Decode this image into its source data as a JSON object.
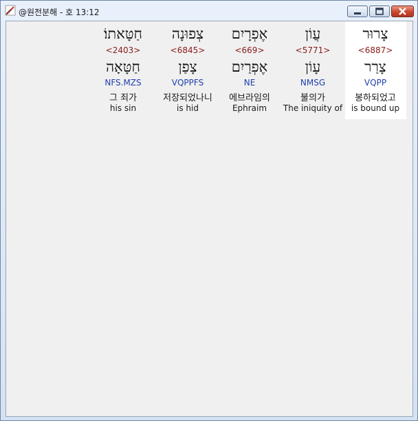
{
  "window": {
    "title": "@원전분해 - 호 13:12",
    "app_icon": "pencil-ruler-icon",
    "controls": [
      "minimize-icon",
      "maximize-icon",
      "close-icon"
    ]
  },
  "words": [
    {
      "hebrew": "צָרוּר",
      "strong": "<6887>",
      "lemma": "צָרַר",
      "morph": "VQPP",
      "korean": "봉하되었고",
      "english": "is bound up",
      "highlighted": true
    },
    {
      "hebrew": "עֲוֹן",
      "strong": "<5771>",
      "lemma": "עָוֹן",
      "morph": "NMSG",
      "korean": "불의가",
      "english": "The iniquity of",
      "highlighted": false
    },
    {
      "hebrew": "אֶפְרָיִם",
      "strong": "<669>",
      "lemma": "אֶפְרַיִם",
      "morph": "NE",
      "korean": "에브라임의",
      "english": "Ephraim",
      "highlighted": false
    },
    {
      "hebrew": "צְפוּנָה",
      "strong": "<6845>",
      "lemma": "צָפַן",
      "morph": "VQPPFS",
      "korean": "저장되었나니",
      "english": "is hid",
      "highlighted": false
    },
    {
      "hebrew": "חַטָּאתוֹ׃",
      "strong": "<2403>",
      "lemma": "חַטָּאָה",
      "morph": "NFS.MZS",
      "korean": "그 죄가",
      "english": "his sin",
      "highlighted": false
    }
  ]
}
